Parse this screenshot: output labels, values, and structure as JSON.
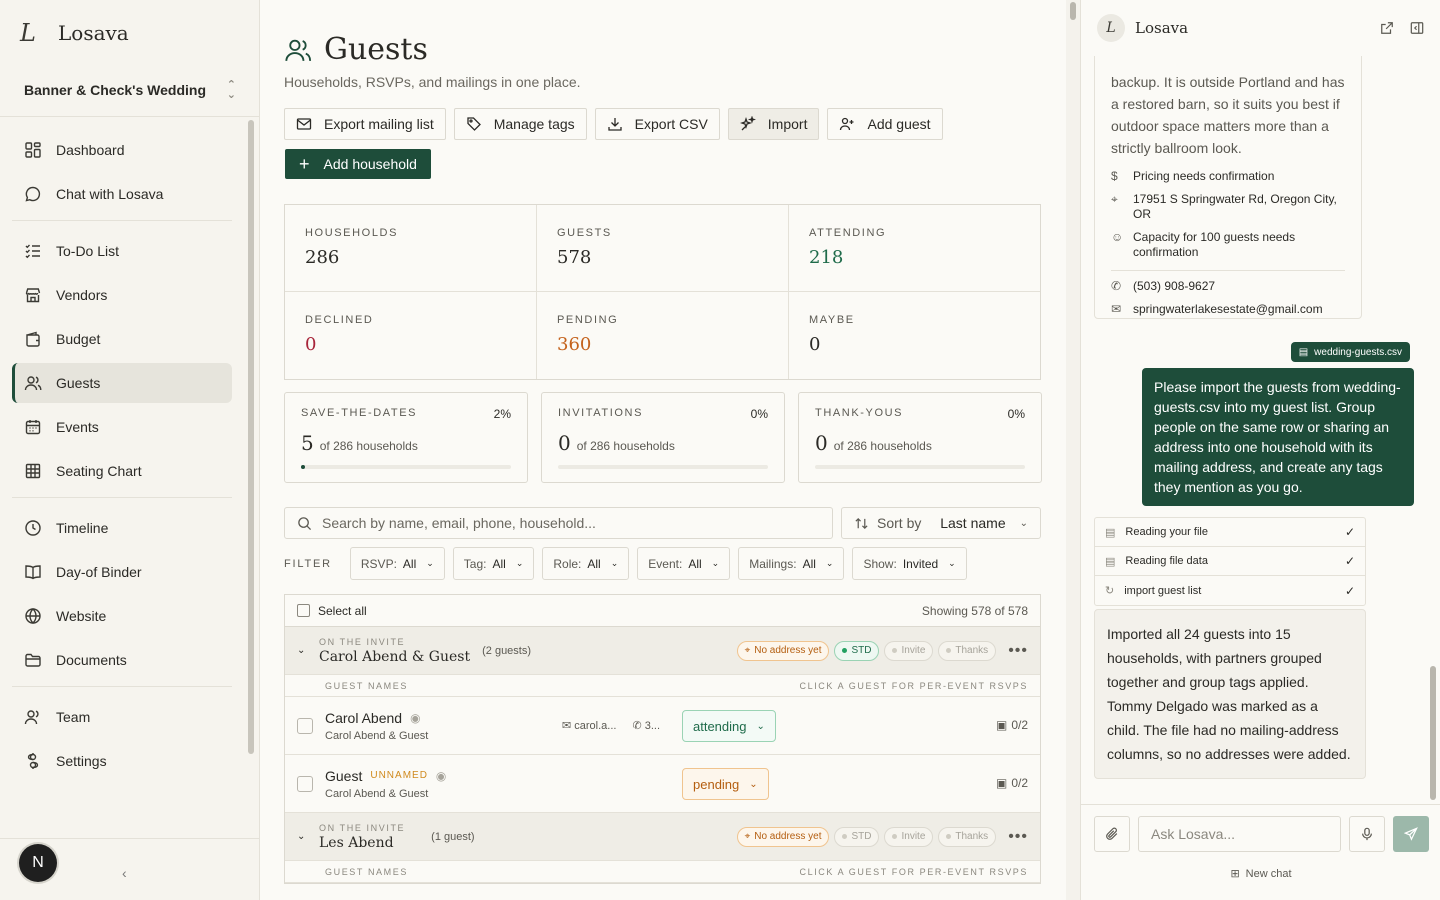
{
  "brand": {
    "name": "Losava",
    "logo_letter": "L"
  },
  "wedding": {
    "name": "Banner & Check's Wedding"
  },
  "nav": {
    "group1": [
      {
        "label": "Dashboard",
        "icon": "dashboard-icon"
      },
      {
        "label": "Chat with Losava",
        "icon": "chat-icon"
      }
    ],
    "group2": [
      {
        "label": "To-Do List",
        "icon": "checklist-icon"
      },
      {
        "label": "Vendors",
        "icon": "store-icon"
      },
      {
        "label": "Budget",
        "icon": "wallet-icon"
      },
      {
        "label": "Guests",
        "icon": "users-icon",
        "active": true
      },
      {
        "label": "Events",
        "icon": "calendar-icon"
      },
      {
        "label": "Seating Chart",
        "icon": "grid-icon"
      }
    ],
    "group3": [
      {
        "label": "Timeline",
        "icon": "clock-icon"
      },
      {
        "label": "Day-of Binder",
        "icon": "book-icon"
      },
      {
        "label": "Website",
        "icon": "globe-icon"
      },
      {
        "label": "Documents",
        "icon": "folder-icon"
      }
    ],
    "group4": [
      {
        "label": "Team",
        "icon": "team-icon"
      },
      {
        "label": "Settings",
        "icon": "settings-icon"
      }
    ]
  },
  "user": {
    "initial": "N"
  },
  "page": {
    "title": "Guests",
    "subtitle": "Households, RSVPs, and mailings in one place."
  },
  "toolbar": {
    "export_mailing": "Export mailing list",
    "manage_tags": "Manage tags",
    "export_csv": "Export CSV",
    "import": "Import",
    "add_guest": "Add guest",
    "add_household": "Add household"
  },
  "stats": [
    {
      "label": "HOUSEHOLDS",
      "value": "286",
      "tone": ""
    },
    {
      "label": "GUESTS",
      "value": "578",
      "tone": ""
    },
    {
      "label": "ATTENDING",
      "value": "218",
      "tone": "green"
    },
    {
      "label": "DECLINED",
      "value": "0",
      "tone": "red"
    },
    {
      "label": "PENDING",
      "value": "360",
      "tone": "orange"
    },
    {
      "label": "MAYBE",
      "value": "0",
      "tone": ""
    }
  ],
  "mailings": [
    {
      "label": "SAVE-THE-DATES",
      "percent": "2%",
      "count": "5",
      "of": "of 286 households",
      "fill": 0.02
    },
    {
      "label": "INVITATIONS",
      "percent": "0%",
      "count": "0",
      "of": "of 286 households",
      "fill": 0
    },
    {
      "label": "THANK-YOUS",
      "percent": "0%",
      "count": "0",
      "of": "of 286 households",
      "fill": 0
    }
  ],
  "search": {
    "placeholder": "Search by name, email, phone, household..."
  },
  "sort": {
    "label": "Sort by",
    "value": "Last name"
  },
  "filters": {
    "label": "FILTER",
    "items": [
      {
        "key": "RSVP:",
        "value": "All"
      },
      {
        "key": "Tag:",
        "value": "All"
      },
      {
        "key": "Role:",
        "value": "All"
      },
      {
        "key": "Event:",
        "value": "All"
      },
      {
        "key": "Mailings:",
        "value": "All"
      },
      {
        "key": "Show:",
        "value": "Invited"
      }
    ]
  },
  "list": {
    "select_all": "Select all",
    "showing": "Showing 578 of 578",
    "households": [
      {
        "on_invite": "ON THE INVITE",
        "name": "Carol Abend & Guest",
        "count": "(2 guests)",
        "address_tag": "No address yet",
        "std": "STD",
        "invite": "Invite",
        "thanks": "Thanks",
        "guest_names": "GUEST NAMES",
        "hint": "CLICK A GUEST FOR PER-EVENT RSVPS",
        "guests": [
          {
            "name": "Carol Abend",
            "household": "Carol Abend & Guest",
            "email": "carol.a...",
            "phone": "3...",
            "rsvp": "attending",
            "events": "0/2",
            "unnamed": ""
          },
          {
            "name": "Guest",
            "household": "Carol Abend & Guest",
            "email": "",
            "phone": "",
            "rsvp": "pending",
            "events": "0/2",
            "unnamed": "UNNAMED"
          }
        ]
      },
      {
        "on_invite": "ON THE INVITE",
        "name": "Les Abend",
        "count": "(1 guest)",
        "address_tag": "No address yet",
        "std": "STD",
        "invite": "Invite",
        "thanks": "Thanks",
        "guest_names": "GUEST NAMES",
        "hint": "CLICK A GUEST FOR PER-EVENT RSVPS"
      }
    ]
  },
  "chat": {
    "title": "Losava",
    "vendor": {
      "text": "backup. It is outside Portland and has a restored barn, so it suits you best if outdoor space matters more than a strictly ballroom look.",
      "pricing": "Pricing needs confirmation",
      "address": "17951 S Springwater Rd, Oregon City, OR",
      "capacity": "Capacity for 100 guests needs confirmation",
      "phone": "(503) 908-9627",
      "email": "springwaterlakesestate@gmail.com"
    },
    "file": "wedding-guests.csv",
    "user_message": "Please import the guests from wedding-guests.csv into my guest list. Group people on the same row or sharing an address into one household with its mailing address, and create any tags they mention as you go.",
    "steps": [
      "Reading your file",
      "Reading file data",
      "import guest list"
    ],
    "assistant_message": "Imported all 24 guests into 15 households, with partners grouped together and group tags applied. Tommy Delgado was marked as a child. The file had no mailing-address columns, so no addresses were added.",
    "input_placeholder": "Ask Losava...",
    "new_chat": "New chat"
  }
}
